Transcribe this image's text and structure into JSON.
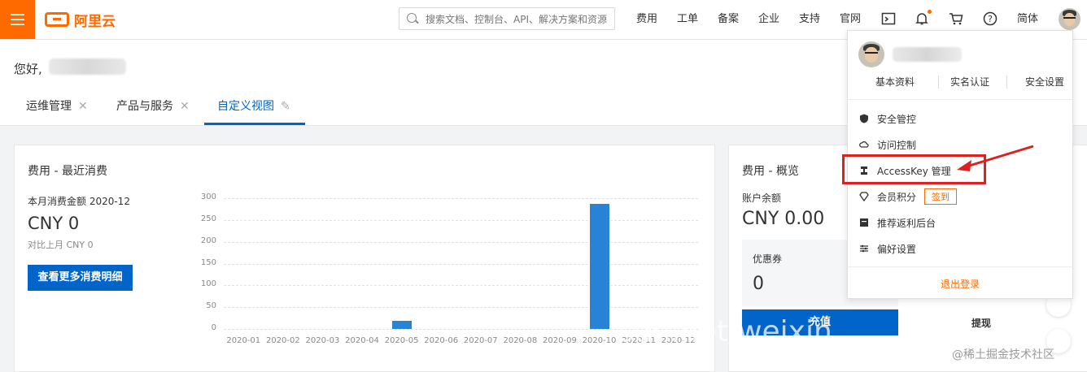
{
  "header": {
    "logo_text": "阿里云",
    "search_placeholder": "搜索文档、控制台、API、解决方案和资源",
    "nav": [
      "费用",
      "工单",
      "备案",
      "企业",
      "支持",
      "官网"
    ],
    "lang": "简体"
  },
  "greeting": "您好,",
  "tabs": [
    {
      "label": "运维管理"
    },
    {
      "label": "产品与服务"
    },
    {
      "label": "自定义视图"
    }
  ],
  "expense_card": {
    "title": "费用 - 最近消费",
    "month_label": "本月消费金额 2020-12",
    "amount": "CNY 0",
    "compare": "对比上月 CNY 0",
    "button": "查看更多消费明细"
  },
  "chart_data": {
    "type": "bar",
    "categories": [
      "2020-01",
      "2020-02",
      "2020-03",
      "2020-04",
      "2020-05",
      "2020-06",
      "2020-07",
      "2020-08",
      "2020-09",
      "2020-10",
      "2020-11",
      "2020-12"
    ],
    "values": [
      0,
      0,
      0,
      0,
      18,
      0,
      0,
      0,
      0,
      287,
      0,
      0
    ],
    "ylim": [
      0,
      300
    ],
    "yticks": [
      "0",
      "50",
      "100",
      "150",
      "200",
      "250",
      "300"
    ],
    "grid": true,
    "color": "#2882d6"
  },
  "overview_card": {
    "title": "费用 - 概览",
    "balance_label": "账户余额",
    "balance": "CNY 0.00",
    "coupon_label": "优惠券",
    "coupon_value": "0",
    "recharge": "充值",
    "withdraw": "提现"
  },
  "dropdown": {
    "links": [
      "基本资料",
      "实名认证",
      "安全设置"
    ],
    "items": [
      {
        "label": "安全管控",
        "icon": "shield-icon"
      },
      {
        "label": "访问控制",
        "icon": "cloud-icon"
      },
      {
        "label": "AccessKey 管理",
        "icon": "key-icon"
      },
      {
        "label": "会员积分",
        "icon": "diamond-icon"
      },
      {
        "label": "推荐返利后台",
        "icon": "gift-icon"
      },
      {
        "label": "偏好设置",
        "icon": "sliders-icon"
      }
    ],
    "signin_badge": "签到",
    "logout": "退出登录"
  },
  "watermark": {
    "url_text": "sdn.net/weixin_",
    "community": "@稀土掘金技术社区"
  },
  "colors": {
    "brand": "#ff6a00",
    "primary": "#0064c8",
    "highlight": "#e02020"
  }
}
